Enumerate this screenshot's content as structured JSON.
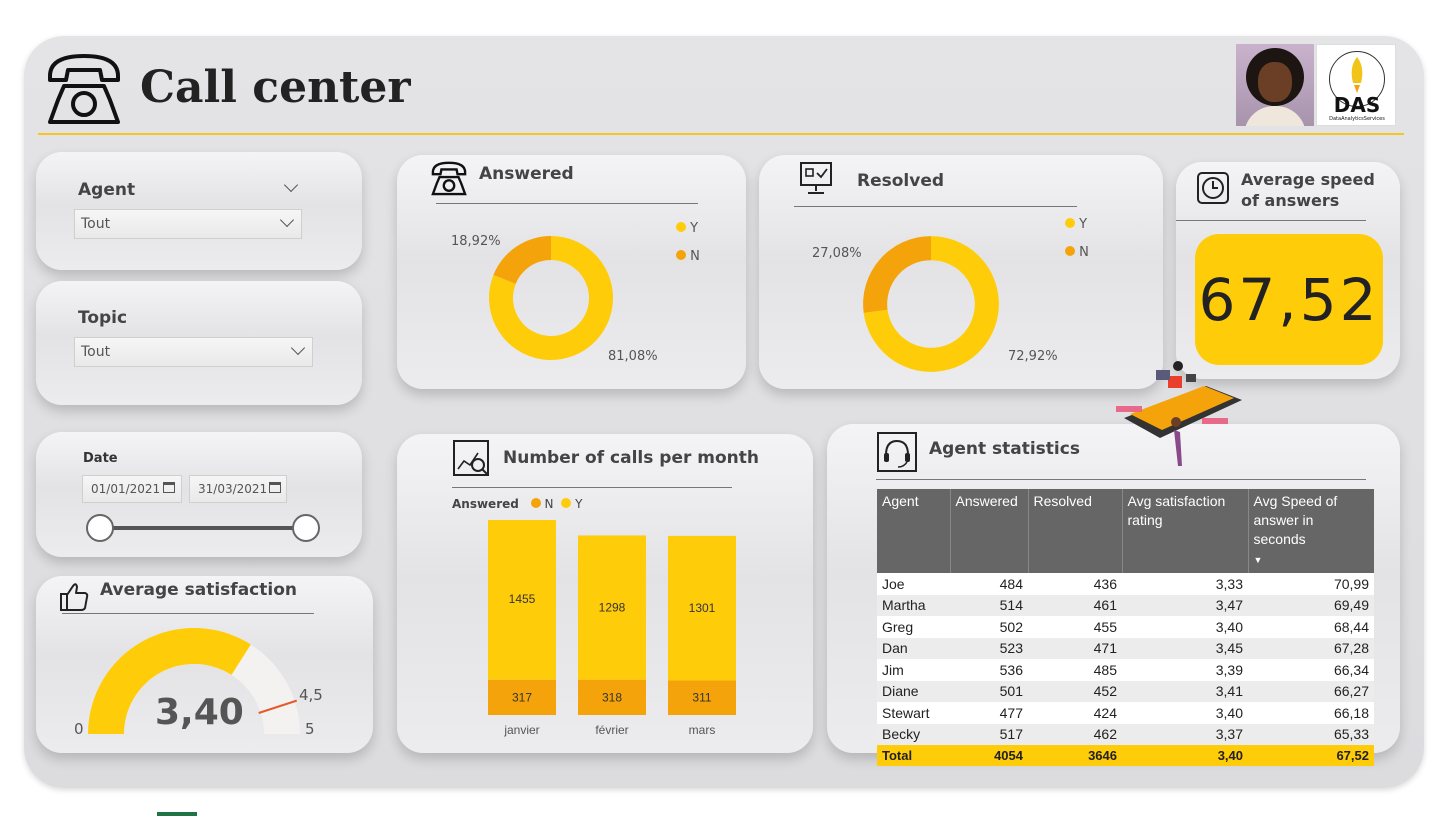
{
  "header": {
    "title": "Call center",
    "logo_text": "DAS",
    "logo_sub": "DataAnalyticsServices"
  },
  "colors": {
    "yellow": "#FFCC0A",
    "orange": "#F5A30A",
    "accent_line": "#F3C623"
  },
  "filters": {
    "agent": {
      "label": "Agent",
      "value": "Tout"
    },
    "topic": {
      "label": "Topic",
      "value": "Tout"
    },
    "date": {
      "label": "Date",
      "start": "01/01/2021",
      "end": "31/03/2021"
    }
  },
  "avg_satisfaction": {
    "title": "Average satisfaction",
    "value": "3,40",
    "min": "0",
    "max": "5",
    "target": "4,5"
  },
  "avg_speed": {
    "title": "Average speed of answers",
    "value": "67,52"
  },
  "chart_data": [
    {
      "type": "pie",
      "title": "Answered",
      "legend": [
        "Y",
        "N"
      ],
      "labels": [
        "81,08%",
        "18,92%"
      ],
      "values": [
        81.08,
        18.92
      ]
    },
    {
      "type": "pie",
      "title": "Resolved",
      "legend": [
        "Y",
        "N"
      ],
      "labels": [
        "72,92%",
        "27,08%"
      ],
      "values": [
        72.92,
        27.08
      ]
    },
    {
      "type": "bar",
      "title": "Number of calls per month",
      "legend_title": "Answered",
      "categories": [
        "janvier",
        "février",
        "mars"
      ],
      "series": [
        {
          "name": "N",
          "values": [
            317,
            318,
            311
          ]
        },
        {
          "name": "Y",
          "values": [
            1455,
            1298,
            1301
          ]
        }
      ]
    },
    {
      "type": "gauge",
      "title": "Average satisfaction",
      "value": 3.4,
      "min": 0,
      "max": 5,
      "target": 4.5
    }
  ],
  "agent_stats": {
    "title": "Agent statistics",
    "columns": [
      "Agent",
      "Answered",
      "Resolved",
      "Avg satisfaction rating",
      "Avg Speed of answer in seconds"
    ],
    "rows": [
      [
        "Joe",
        "484",
        "436",
        "3,33",
        "70,99"
      ],
      [
        "Martha",
        "514",
        "461",
        "3,47",
        "69,49"
      ],
      [
        "Greg",
        "502",
        "455",
        "3,40",
        "68,44"
      ],
      [
        "Dan",
        "523",
        "471",
        "3,45",
        "67,28"
      ],
      [
        "Jim",
        "536",
        "485",
        "3,39",
        "66,34"
      ],
      [
        "Diane",
        "501",
        "452",
        "3,41",
        "66,27"
      ],
      [
        "Stewart",
        "477",
        "424",
        "3,40",
        "66,18"
      ],
      [
        "Becky",
        "517",
        "462",
        "3,37",
        "65,33"
      ]
    ],
    "total": [
      "Total",
      "4054",
      "3646",
      "3,40",
      "67,52"
    ]
  }
}
